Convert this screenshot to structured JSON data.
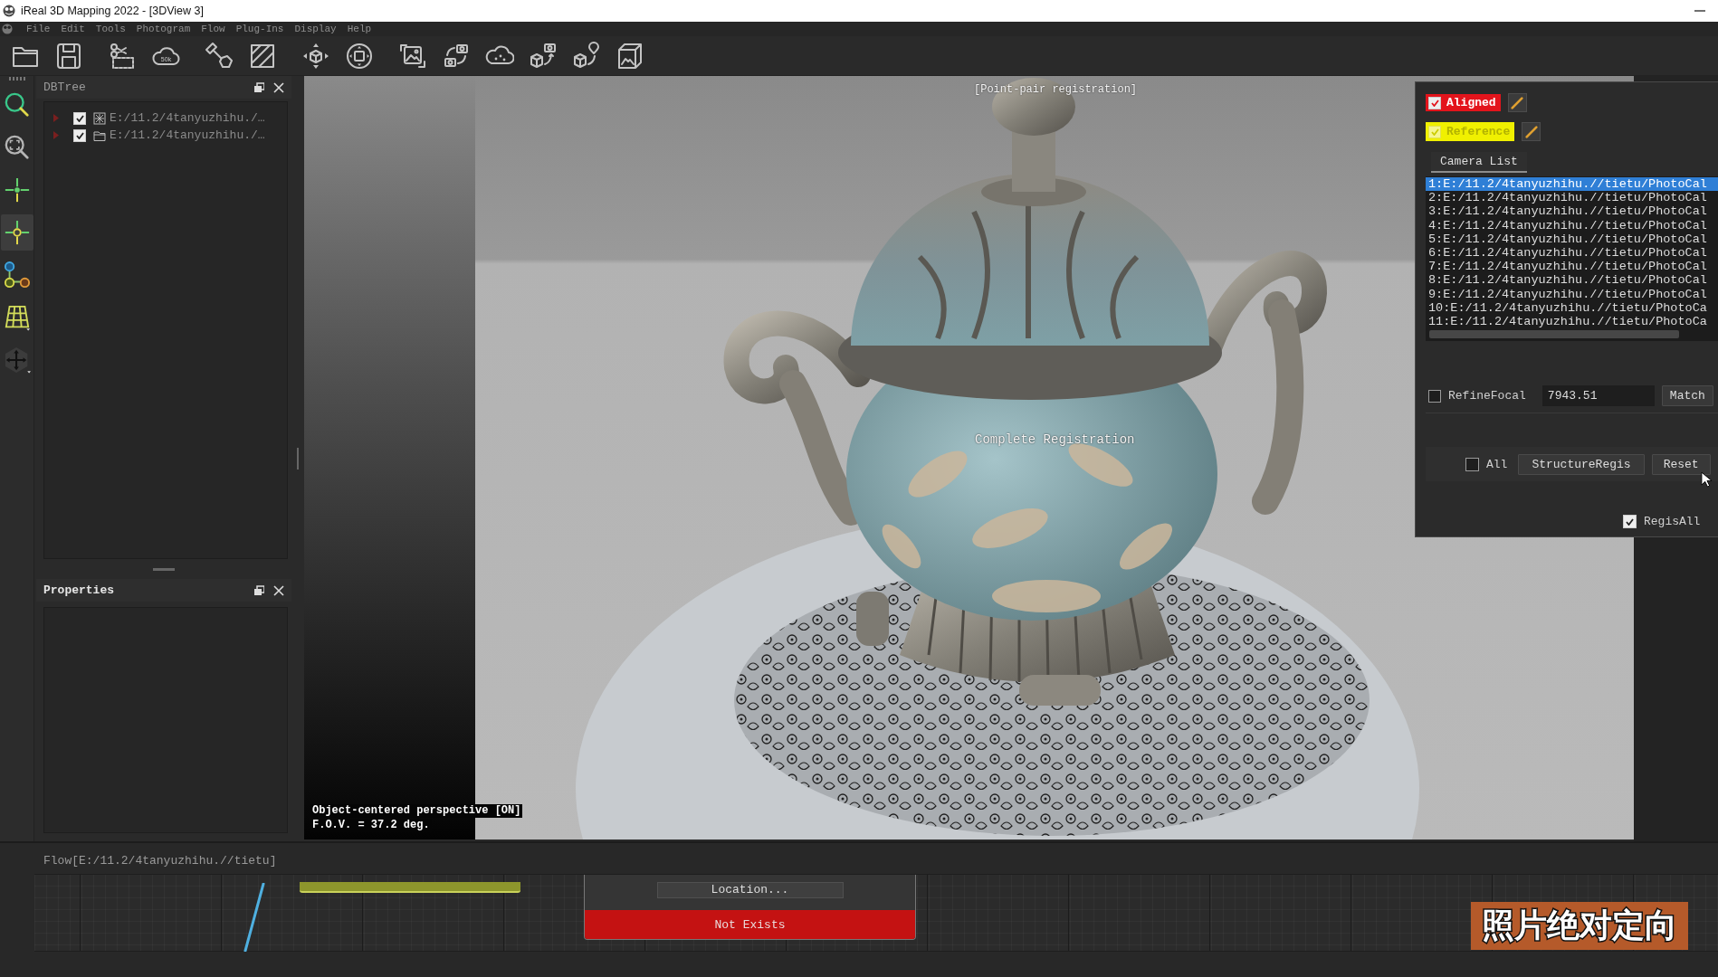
{
  "window": {
    "title": "iReal 3D Mapping 2022 - [3DView 3]"
  },
  "menu": [
    "File",
    "Edit",
    "Tools",
    "Photogram",
    "Flow",
    "Plug-Ins",
    "Display",
    "Help"
  ],
  "toolbar": {
    "cloud_label": "50k"
  },
  "tool_strip": [
    {
      "selected": false
    },
    {
      "selected": false
    },
    {
      "selected": false
    },
    {
      "selected": true
    },
    {
      "selected": false
    },
    {
      "selected": false
    },
    {
      "selected": false
    }
  ],
  "db_tree": {
    "title": "DBTree",
    "items": [
      {
        "kind": "model",
        "label": "E:/11.2/4tanyuzhihu./…",
        "checked": true,
        "expanded": false
      },
      {
        "kind": "folder",
        "label": "E:/11.2/4tanyuzhihu./…",
        "checked": true,
        "expanded": false
      }
    ]
  },
  "properties": {
    "title": "Properties"
  },
  "viewport": {
    "mode_label": "[Point-pair registration]",
    "message": "Complete Registration",
    "perspective": "Object-centered perspective [ON]",
    "fov": "F.O.V. = 37.2 deg."
  },
  "registration_panel": {
    "layers": [
      {
        "label": "Aligned",
        "checked": true,
        "color": "#e3141c"
      },
      {
        "label": "Reference",
        "checked": true,
        "color": "#f0f000"
      }
    ],
    "tabs": [
      {
        "label": "Camera List",
        "selected": true
      }
    ],
    "cameras": [
      {
        "label": "1:E:/11.2/4tanyuzhihu.//tietu/PhotoCal",
        "selected": true
      },
      {
        "label": "2:E:/11.2/4tanyuzhihu.//tietu/PhotoCal",
        "selected": false
      },
      {
        "label": "3:E:/11.2/4tanyuzhihu.//tietu/PhotoCal",
        "selected": false
      },
      {
        "label": "4:E:/11.2/4tanyuzhihu.//tietu/PhotoCal",
        "selected": false
      },
      {
        "label": "5:E:/11.2/4tanyuzhihu.//tietu/PhotoCal",
        "selected": false
      },
      {
        "label": "6:E:/11.2/4tanyuzhihu.//tietu/PhotoCal",
        "selected": false
      },
      {
        "label": "7:E:/11.2/4tanyuzhihu.//tietu/PhotoCal",
        "selected": false
      },
      {
        "label": "8:E:/11.2/4tanyuzhihu.//tietu/PhotoCal",
        "selected": false
      },
      {
        "label": "9:E:/11.2/4tanyuzhihu.//tietu/PhotoCal",
        "selected": false
      },
      {
        "label": "10:E:/11.2/4tanyuzhihu.//tietu/PhotoCa",
        "selected": false
      },
      {
        "label": "11:E:/11.2/4tanyuzhihu.//tietu/PhotoCa",
        "selected": false
      }
    ],
    "refine_focal": {
      "label": "RefineFocal",
      "checked": false,
      "value": "7943.51"
    },
    "match_button": "Match",
    "all": {
      "label": "All",
      "checked": false
    },
    "buttons": [
      "StructureRegis",
      "Reset"
    ],
    "regis_all": {
      "label": "RegisAll",
      "checked": true
    }
  },
  "flow": {
    "path": "Flow[E:/11.2/4tanyuzhihu.//tietu]",
    "node": {
      "button": "Location...",
      "status": "Not Exists"
    }
  },
  "caption": "照片绝对定向"
}
